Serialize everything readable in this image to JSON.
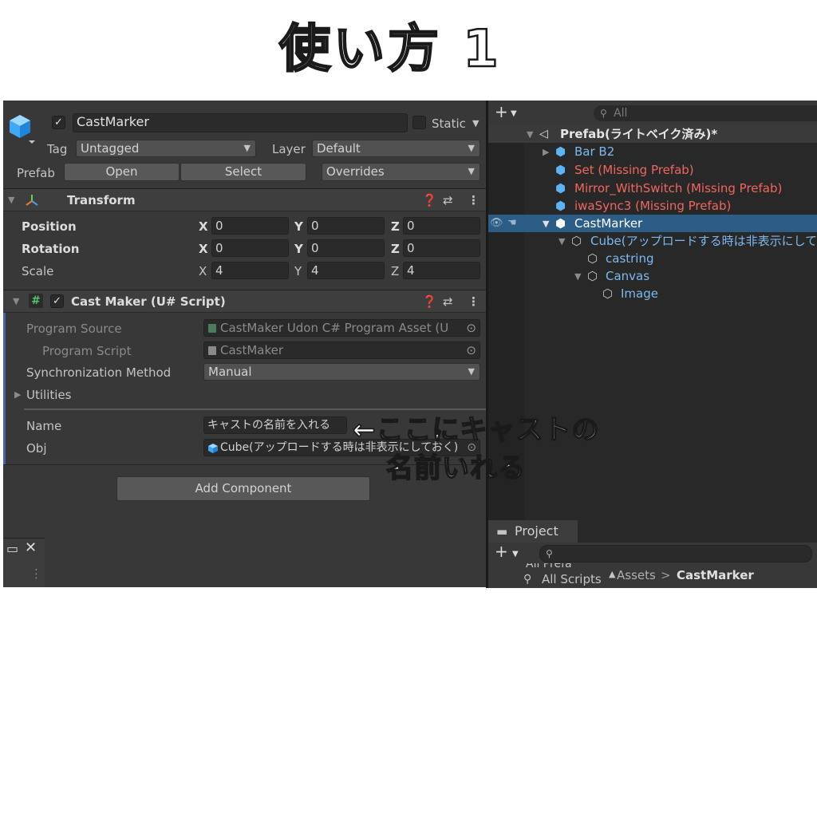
{
  "heading": "使い方 1",
  "annotation": {
    "line1": "←ここにキャストの",
    "line2": "名前いれる"
  },
  "inspector": {
    "object_name": "CastMarker",
    "static_label": "Static",
    "tag_label": "Tag",
    "tag_value": "Untagged",
    "layer_label": "Layer",
    "layer_value": "Default",
    "prefab_label": "Prefab",
    "open_label": "Open",
    "select_label": "Select",
    "overrides_label": "Overrides",
    "transform": {
      "title": "Transform",
      "position_label": "Position",
      "rotation_label": "Rotation",
      "scale_label": "Scale",
      "axis_x": "X",
      "axis_y": "Y",
      "axis_z": "Z",
      "position": [
        "0",
        "0",
        "0"
      ],
      "rotation": [
        "0",
        "0",
        "0"
      ],
      "scale": [
        "4",
        "4",
        "4"
      ]
    },
    "script": {
      "title": "Cast Maker (U# Script)",
      "program_source_label": "Program Source",
      "program_source_value": "CastMaker Udon C# Program Asset (U",
      "program_script_label": "Program Script",
      "program_script_value": "CastMaker",
      "sync_label": "Synchronization Method",
      "sync_value": "Manual",
      "utilities_label": "Utilities",
      "name_label": "Name",
      "name_value": "キャストの名前を入れる",
      "obj_label": "Obj",
      "obj_value": "Cube(アップロードする時は非表示にしておく)"
    },
    "add_component_label": "Add Component"
  },
  "hierarchy": {
    "search_placeholder": "All",
    "items": [
      {
        "label": "Prefab(ライトベイク済み)*",
        "color": "#e6e6e6"
      },
      {
        "label": "Bar B2",
        "color": "#7cb9f0"
      },
      {
        "label": "Set (Missing Prefab)",
        "color": "#f0665e"
      },
      {
        "label": "Mirror_WithSwitch (Missing Prefab)",
        "color": "#f0665e"
      },
      {
        "label": "iwaSync3 (Missing Prefab)",
        "color": "#f0665e"
      },
      {
        "label": "CastMarker",
        "color": "#ffffff"
      },
      {
        "label": "Cube(アップロードする時は非表示にしておく)",
        "color": "#7cb9f0"
      },
      {
        "label": "castring",
        "color": "#7cb9f0"
      },
      {
        "label": "Canvas",
        "color": "#7cb9f0"
      },
      {
        "label": "Image",
        "color": "#7cb9f0"
      }
    ]
  },
  "project": {
    "tab_label": "Project",
    "all_prefabs": "All Prefa",
    "all_scripts": "All Scripts",
    "breadcrumb_root": "Assets",
    "breadcrumb_separator": ">",
    "breadcrumb_current": "CastMarker"
  }
}
